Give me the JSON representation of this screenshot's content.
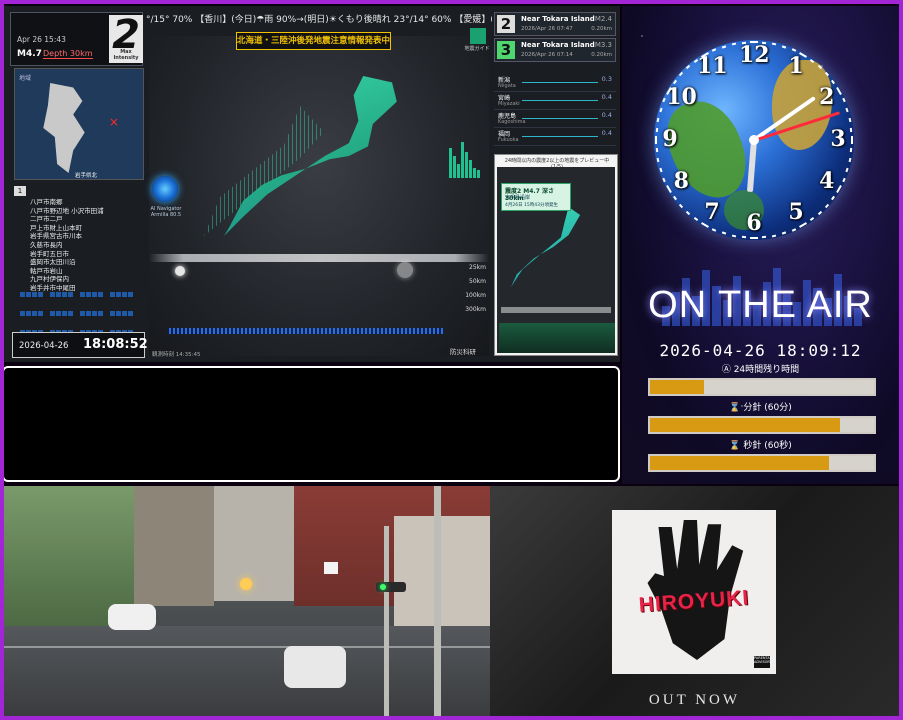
{
  "quake": {
    "ticker": "°/15° 70% 【香川】(今日)☂雨 90%→(明日)☀くもり後晴れ 23°/14° 60% 【愛媛】(今日)☂雨 70%→(明日",
    "warning": "北海道・三陸沖後発地震注意情報発表中",
    "intensity": {
      "date": "Apr 26 15:43",
      "magnitude": "M4.7",
      "depth": "Depth 30km",
      "value": "2",
      "caption": "Max Intensity"
    },
    "minimap_label": "地域",
    "minimap_foot": "岩手県北",
    "list_number": "1",
    "locations": [
      "八戸市南郷",
      "八戸市野辺地 小沢市田浦",
      "二戸市二戸",
      "戸上市財上山本町",
      "岩手県宮古市川本",
      "久慈市長内",
      "岩手町五日市",
      "盛岡市太田川沿",
      "軲戸市岩山",
      "九戸村伊保内",
      "岩手井市中尾田"
    ],
    "time": {
      "date": "2026-04-26",
      "clock": "18:08:52"
    },
    "ai_label": "AI Navigator Armilla 80.5",
    "depth_axis": [
      "25km",
      "50km",
      "100km",
      "300km"
    ],
    "timestamp": "観測時刻 14:35:45",
    "nied_logo": "防災科研",
    "nied_caption": "地震ガイド",
    "events": [
      {
        "num": "2",
        "place": "Near Tokara Island",
        "date": "2026/Apr 26 07:47",
        "mag": "M2.4",
        "depth": "0.20km",
        "color": "#ffffff"
      },
      {
        "num": "3",
        "place": "Near Tokara Island",
        "date": "2026/Apr 26 07:14",
        "mag": "M3.3",
        "depth": "0.20km",
        "color": "#4fd66e"
      }
    ],
    "stations": [
      {
        "name": "新潟",
        "en": "Niigata",
        "value": "0.3"
      },
      {
        "name": "宮崎",
        "en": "Miyazaki",
        "value": "0.4"
      },
      {
        "name": "鹿児島",
        "en": "Kagoshima",
        "value": "0.4"
      },
      {
        "name": "福岡",
        "en": "Fukuoka",
        "value": "0.4"
      }
    ],
    "preview": {
      "caption": "24時間以内の震度2以上の地震をプレビュー中 (1/5)",
      "shindo": "震度2 M4.7 深さ30km",
      "region": "岩手県沿岸",
      "datetime": "4月26日 15時43分頃発生"
    }
  },
  "clock": {
    "numerals": [
      "12",
      "1",
      "2",
      "3",
      "4",
      "5",
      "6",
      "7",
      "8",
      "9",
      "10",
      "11"
    ],
    "time": {
      "hours": 18,
      "minutes": 9,
      "seconds": 12
    },
    "on_air": "ON THE AIR",
    "datetime": "2026-04-26 18:09:12",
    "bars": [
      {
        "label": "Ⓐ 24時間残り時間",
        "fill": 0.24
      },
      {
        "label": "⌛ 分針 (60分)",
        "fill": 0.85
      },
      {
        "label": "⌛ 秒針 (60秒)",
        "fill": 0.8
      }
    ]
  },
  "album": {
    "title": "HIROYUKI",
    "explicit": "PARENTAL ADVISORY",
    "footer": "OUT NOW"
  },
  "colors": {
    "frame": "#a225d6",
    "accent_bar": "#d79a12",
    "warning": "#f2c200"
  }
}
